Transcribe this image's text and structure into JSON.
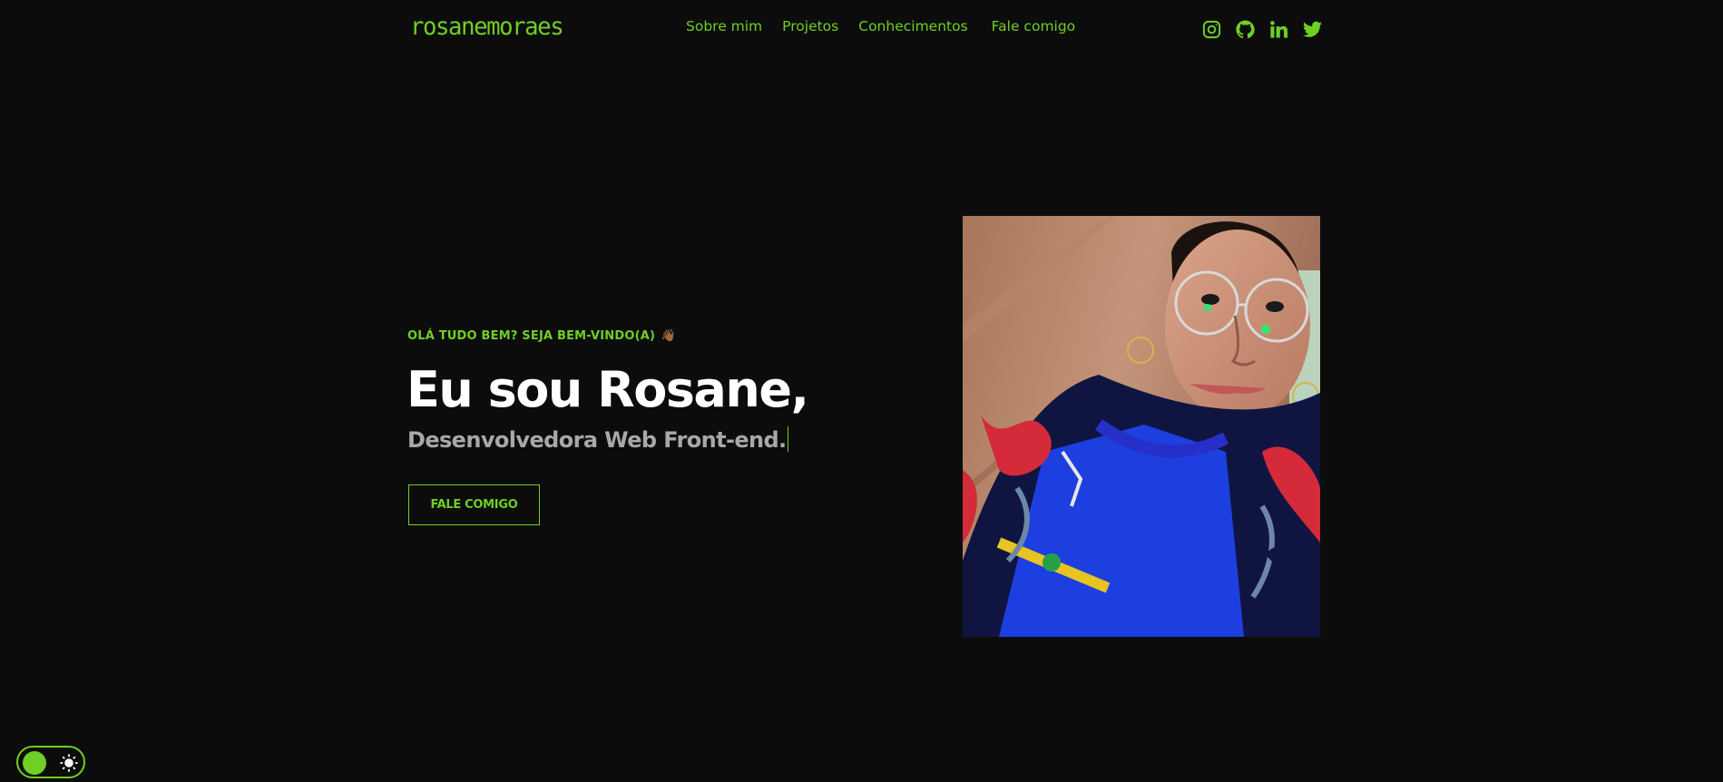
{
  "brand": {
    "logo": "rosanemoraes",
    "accent": "#6fcf24",
    "background": "#0c0c0c"
  },
  "nav": {
    "items": [
      {
        "label": "Sobre mim"
      },
      {
        "label": "Projetos"
      },
      {
        "label": "Conhecimentos"
      },
      {
        "label": "Fale comigo"
      }
    ]
  },
  "socials": [
    "instagram-icon",
    "github-icon",
    "linkedin-icon",
    "twitter-icon"
  ],
  "hero": {
    "greeting": "OLÁ TUDO BEM? SEJA BEM-VINDO(A)",
    "greeting_emoji": "👋🏾",
    "headline": "Eu sou Rosane,",
    "subtitle": "Desenvolvedora Web Front-end.",
    "cta_label": "FALE COMIGO"
  },
  "theme_toggle": {
    "mode": "dark",
    "icon": "sun-icon"
  }
}
